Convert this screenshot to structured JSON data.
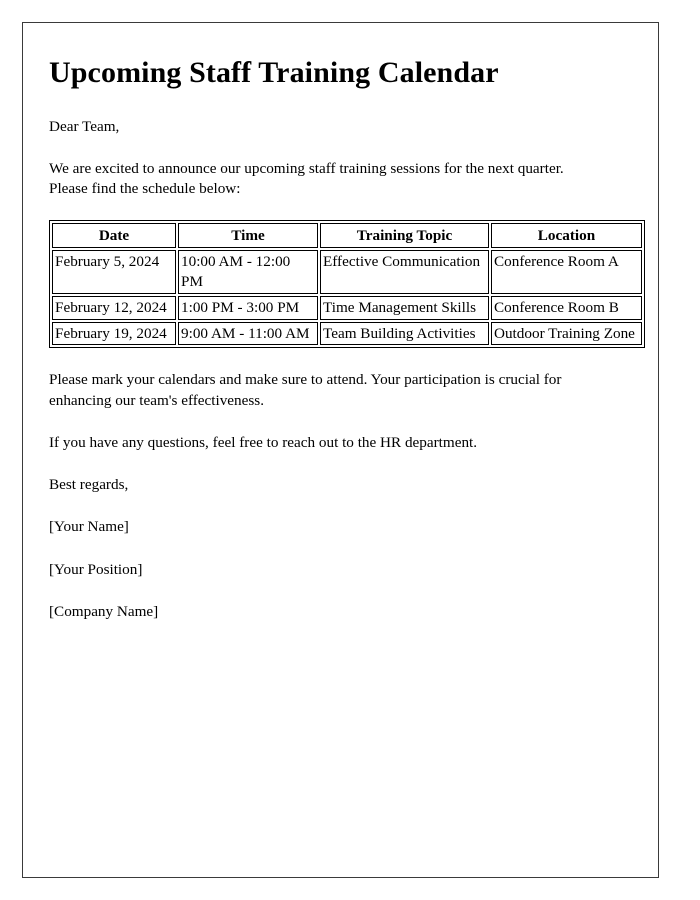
{
  "document": {
    "title": "Upcoming Staff Training Calendar",
    "greeting": "Dear Team,",
    "intro": "We are excited to announce our upcoming staff training sessions for the next quarter. Please find the schedule below:",
    "closing_note": "Please mark your calendars and make sure to attend. Your participation is crucial for enhancing our team's effectiveness.",
    "questions_note": "If you have any questions, feel free to reach out to the HR department.",
    "sign_off": "Best regards,",
    "signature": [
      "[Your Name]",
      "[Your Position]",
      "[Company Name]"
    ]
  },
  "table": {
    "headers": [
      "Date",
      "Time",
      "Training Topic",
      "Location"
    ],
    "rows": [
      {
        "date": "February 5, 2024",
        "time": "10:00 AM - 12:00 PM",
        "topic": "Effective Communication",
        "location": "Conference Room A"
      },
      {
        "date": "February 12, 2024",
        "time": "1:00 PM - 3:00 PM",
        "topic": "Time Management Skills",
        "location": "Conference Room B"
      },
      {
        "date": "February 19, 2024",
        "time": "9:00 AM - 11:00 AM",
        "topic": "Team Building Activities",
        "location": "Outdoor Training Zone"
      }
    ]
  },
  "colors": {
    "text": "#000000",
    "page_border": "#3a3a3a",
    "table_border": "#000000",
    "background": "#ffffff"
  }
}
